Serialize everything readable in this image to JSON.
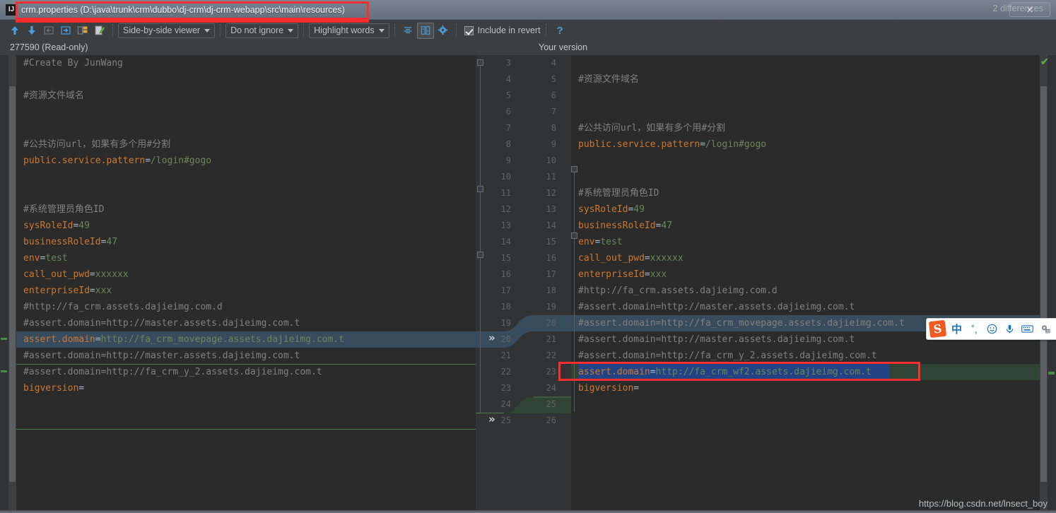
{
  "window": {
    "title": "crm.properties (D:\\java\\trunk\\crm\\dubbo\\dj-crm\\dj-crm-webapp\\src\\main\\resources)",
    "icon": "idea-file-icon",
    "close_label": "✕"
  },
  "toolbar": {
    "icons": [
      {
        "name": "previous-difference-icon",
        "glyph": "arrow-up"
      },
      {
        "name": "next-difference-icon",
        "glyph": "arrow-down"
      },
      {
        "name": "apply-left-icon",
        "glyph": "arrow-left-box"
      },
      {
        "name": "apply-right-icon",
        "glyph": "arrow-right-box"
      },
      {
        "name": "compare-files-icon",
        "glyph": "compare"
      },
      {
        "name": "edit-source-icon",
        "glyph": "edit-pencil"
      }
    ],
    "viewer_mode": "Side-by-side viewer",
    "ignore_policy": "Do not ignore",
    "highlight_policy": "Highlight words",
    "collapse_unchanged_label": "collapse-unchanged-icon",
    "synchronize_label": "synchronize-scrolling-icon",
    "settings_label": "settings-gear-icon",
    "include_in_revert_label": "Include in revert",
    "include_in_revert_checked": true,
    "help_label": "?",
    "differences_count": "2 differences"
  },
  "headers": {
    "left": "277590 (Read-only)",
    "right": "Your version"
  },
  "left_pane": {
    "lines": [
      {
        "n": "3",
        "segs": [
          {
            "t": "#Create By JunWang",
            "c": "c-comment"
          }
        ]
      },
      {
        "n": "4",
        "segs": []
      },
      {
        "n": "5",
        "segs": [
          {
            "t": "#资源文件域名",
            "c": "c-comment"
          }
        ]
      },
      {
        "n": "6",
        "segs": []
      },
      {
        "n": "7",
        "segs": []
      },
      {
        "n": "8",
        "segs": [
          {
            "t": "#公共访问url，如果有多个用#分割",
            "c": "c-comment"
          }
        ]
      },
      {
        "n": "9",
        "segs": [
          {
            "t": "public.service.pattern",
            "c": "c-key"
          },
          {
            "t": "=",
            "c": "c-eq"
          },
          {
            "t": "/login#gogo",
            "c": "c-val"
          }
        ]
      },
      {
        "n": "10",
        "segs": []
      },
      {
        "n": "11",
        "segs": []
      },
      {
        "n": "12",
        "segs": [
          {
            "t": "#系统管理员角色ID",
            "c": "c-comment"
          }
        ]
      },
      {
        "n": "13",
        "segs": [
          {
            "t": "sysRoleId",
            "c": "c-key"
          },
          {
            "t": "=",
            "c": "c-eq"
          },
          {
            "t": "49",
            "c": "c-val"
          }
        ]
      },
      {
        "n": "14",
        "segs": [
          {
            "t": "businessRoleId",
            "c": "c-key"
          },
          {
            "t": "=",
            "c": "c-eq"
          },
          {
            "t": "47",
            "c": "c-val"
          }
        ]
      },
      {
        "n": "15",
        "segs": [
          {
            "t": "env",
            "c": "c-key"
          },
          {
            "t": "=",
            "c": "c-eq"
          },
          {
            "t": "test",
            "c": "c-val"
          }
        ]
      },
      {
        "n": "16",
        "segs": [
          {
            "t": "call_out_pwd",
            "c": "c-key"
          },
          {
            "t": "=",
            "c": "c-eq"
          },
          {
            "t": "xxxxxx",
            "c": "c-val"
          }
        ]
      },
      {
        "n": "17",
        "segs": [
          {
            "t": "enterpriseId",
            "c": "c-key"
          },
          {
            "t": "=",
            "c": "c-eq"
          },
          {
            "t": "xxx",
            "c": "c-val"
          }
        ]
      },
      {
        "n": "18",
        "segs": [
          {
            "t": "#http://fa_crm.assets.dajieimg.com.d",
            "c": "c-comment"
          }
        ]
      },
      {
        "n": "19",
        "segs": [
          {
            "t": "#assert.domain=http://master.assets.dajieimg.com.t",
            "c": "c-comment"
          }
        ]
      },
      {
        "n": "20",
        "segs": [
          {
            "t": "assert.domain",
            "c": "c-key"
          },
          {
            "t": "=",
            "c": "c-eq"
          },
          {
            "t": "http://fa_crm_movepage.assets.dajieimg.com.t",
            "c": "c-val"
          }
        ]
      },
      {
        "n": "21",
        "segs": [
          {
            "t": "#assert.domain=http://master.assets.dajieimg.com.t",
            "c": "c-comment"
          }
        ]
      },
      {
        "n": "22",
        "segs": [
          {
            "t": "#assert.domain=http://fa_crm_y_2.assets.dajieimg.com.t",
            "c": "c-comment"
          }
        ]
      },
      {
        "n": "23",
        "segs": [
          {
            "t": "bigversion",
            "c": "c-key"
          },
          {
            "t": "=",
            "c": "c-eq"
          }
        ]
      },
      {
        "n": "24",
        "segs": []
      },
      {
        "n": "25",
        "segs": []
      }
    ]
  },
  "right_pane": {
    "lines": [
      {
        "n": "4",
        "segs": []
      },
      {
        "n": "5",
        "segs": [
          {
            "t": "#资源文件域名",
            "c": "c-comment"
          }
        ]
      },
      {
        "n": "6",
        "segs": []
      },
      {
        "n": "7",
        "segs": []
      },
      {
        "n": "8",
        "segs": [
          {
            "t": "#公共访问url，如果有多个用#分割",
            "c": "c-comment"
          }
        ]
      },
      {
        "n": "9",
        "segs": [
          {
            "t": "public.service.pattern",
            "c": "c-key"
          },
          {
            "t": "=",
            "c": "c-eq"
          },
          {
            "t": "/login#gogo",
            "c": "c-val"
          }
        ]
      },
      {
        "n": "10",
        "segs": []
      },
      {
        "n": "11",
        "segs": []
      },
      {
        "n": "12",
        "segs": [
          {
            "t": "#系统管理员角色ID",
            "c": "c-comment"
          }
        ]
      },
      {
        "n": "13",
        "segs": [
          {
            "t": "sysRoleId",
            "c": "c-key"
          },
          {
            "t": "=",
            "c": "c-eq"
          },
          {
            "t": "49",
            "c": "c-val"
          }
        ]
      },
      {
        "n": "14",
        "segs": [
          {
            "t": "businessRoleId",
            "c": "c-key"
          },
          {
            "t": "=",
            "c": "c-eq"
          },
          {
            "t": "47",
            "c": "c-val"
          }
        ]
      },
      {
        "n": "15",
        "segs": [
          {
            "t": "env",
            "c": "c-key"
          },
          {
            "t": "=",
            "c": "c-eq"
          },
          {
            "t": "test",
            "c": "c-val"
          }
        ]
      },
      {
        "n": "16",
        "segs": [
          {
            "t": "call_out_pwd",
            "c": "c-key"
          },
          {
            "t": "=",
            "c": "c-eq"
          },
          {
            "t": "xxxxxx",
            "c": "c-val"
          }
        ]
      },
      {
        "n": "17",
        "segs": [
          {
            "t": "enterpriseId",
            "c": "c-key"
          },
          {
            "t": "=",
            "c": "c-eq"
          },
          {
            "t": "xxx",
            "c": "c-val"
          }
        ]
      },
      {
        "n": "18",
        "segs": [
          {
            "t": "#http://fa_crm.assets.dajieimg.com.d",
            "c": "c-comment"
          }
        ]
      },
      {
        "n": "19",
        "segs": [
          {
            "t": "#assert.domain=http://master.assets.dajieimg.com.t",
            "c": "c-comment"
          }
        ]
      },
      {
        "n": "20",
        "segs": [
          {
            "t": "#assert.domain=http://fa_crm_movepage.assets.dajieimg.com.t",
            "c": "c-comment"
          }
        ]
      },
      {
        "n": "21",
        "segs": [
          {
            "t": "#assert.domain=http://master.assets.dajieimg.com.t",
            "c": "c-comment"
          }
        ]
      },
      {
        "n": "22",
        "segs": [
          {
            "t": "#assert.domain=http://fa_crm_y_2.assets.dajieimg.com.t",
            "c": "c-comment"
          }
        ]
      },
      {
        "n": "23",
        "segs": [
          {
            "t": "assert.domain",
            "c": "c-key"
          },
          {
            "t": "=",
            "c": "c-eq"
          },
          {
            "t": "http://fa_crm_wf2.assets.dajieimg.com.t",
            "c": "c-val"
          }
        ]
      },
      {
        "n": "24",
        "segs": [
          {
            "t": "bigversion",
            "c": "c-key"
          },
          {
            "t": "=",
            "c": "c-eq"
          }
        ]
      },
      {
        "n": "25",
        "segs": []
      },
      {
        "n": "26",
        "segs": []
      }
    ]
  },
  "gutter": {
    "accept_chevrons": [
      "»",
      "»"
    ]
  },
  "ime": {
    "logo": "S",
    "items": [
      {
        "name": "chinese-mode-toggle",
        "glyph": "中"
      },
      {
        "name": "punctuation-toggle",
        "glyph": "˚,"
      },
      {
        "name": "emoji-icon",
        "glyph": "☺"
      },
      {
        "name": "voice-input-icon",
        "glyph": "ᵟ"
      },
      {
        "name": "soft-keyboard-icon",
        "glyph": "⌨"
      },
      {
        "name": "toolbox-icon",
        "glyph": "⚙"
      },
      {
        "name": "skin-icon",
        "glyph": "ŧ"
      }
    ]
  },
  "watermark": "https://blog.csdn.net/lnsect_boy",
  "colors": {
    "changed": "#384c5e",
    "added": "#2f4435",
    "selected": "#214283",
    "annotation": "#ff2d2d",
    "keyword": "#cc7832",
    "value": "#6a8759",
    "comment": "#808080"
  }
}
